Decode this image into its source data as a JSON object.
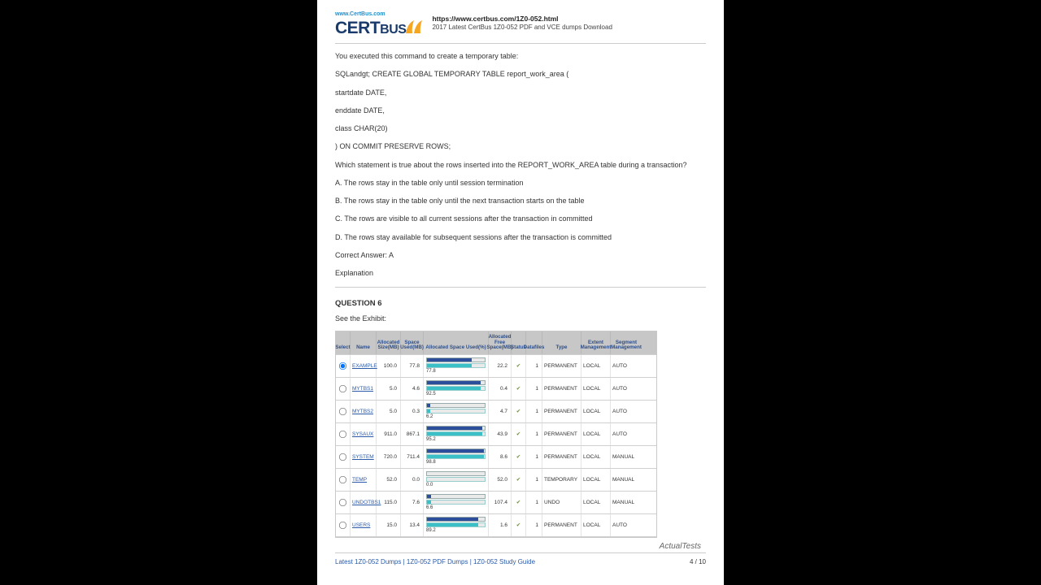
{
  "header": {
    "logo_url": "www.CertBus.com",
    "logo_main": "CERT",
    "logo_suffix": "BUS",
    "url_line": "https://www.certbus.com/1Z0-052.html",
    "subtitle": "2017 Latest CertBus 1Z0-052 PDF and VCE dumps Download"
  },
  "body": {
    "p1": "You executed this command to create a temporary table:",
    "p2": "SQLandgt; CREATE GLOBAL TEMPORARY TABLE report_work_area (",
    "p3": "startdate DATE,",
    "p4": "enddate DATE,",
    "p5": "class CHAR(20)",
    "p6": ") ON COMMIT PRESERVE ROWS;",
    "p7": "Which statement is true about the rows inserted into the REPORT_WORK_AREA table during a transaction?",
    "optA": "A. The rows stay in the table only until session termination",
    "optB": "B. The rows stay in the table only until the next transaction starts on the table",
    "optC": "C. The rows are visible to all current sessions after the transaction in committed",
    "optD": "D. The rows stay available for subsequent sessions after the transaction is committed",
    "answer": "Correct Answer: A",
    "expl": "Explanation"
  },
  "q6": {
    "title": "QUESTION 6",
    "see": "See the Exhibit:",
    "headers": [
      "Select",
      "Name",
      "Allocated Size(MB)",
      "Space Used(MB)",
      "Allocated Space Used(%)",
      "Allocated Free Space(MB)",
      "Status",
      "Datafiles",
      "Type",
      "Extent Management",
      "Segment Management"
    ],
    "rows": [
      {
        "sel": true,
        "name": "EXAMPLE",
        "alloc": "100.0",
        "used": "77.8",
        "pct_top": 77.8,
        "pct_bot": 77.8,
        "lbl": "77.8",
        "free": "22.2",
        "status": "✔",
        "datafiles": "1",
        "type": "PERMANENT",
        "ext": "LOCAL",
        "seg": "AUTO"
      },
      {
        "sel": false,
        "name": "MYTBS1",
        "alloc": "5.0",
        "used": "4.6",
        "pct_top": 92.5,
        "pct_bot": 92.5,
        "lbl": "92.5",
        "free": "0.4",
        "status": "✔",
        "datafiles": "1",
        "type": "PERMANENT",
        "ext": "LOCAL",
        "seg": "AUTO"
      },
      {
        "sel": false,
        "name": "MYTBS2",
        "alloc": "5.0",
        "used": "0.3",
        "pct_top": 6.2,
        "pct_bot": 6.2,
        "lbl": "6.2",
        "free": "4.7",
        "status": "✔",
        "datafiles": "1",
        "type": "PERMANENT",
        "ext": "LOCAL",
        "seg": "AUTO"
      },
      {
        "sel": false,
        "name": "SYSAUX",
        "alloc": "911.0",
        "used": "867.1",
        "pct_top": 95.2,
        "pct_bot": 95.2,
        "lbl": "95.2",
        "free": "43.9",
        "status": "✔",
        "datafiles": "1",
        "type": "PERMANENT",
        "ext": "LOCAL",
        "seg": "AUTO"
      },
      {
        "sel": false,
        "name": "SYSTEM",
        "alloc": "720.0",
        "used": "711.4",
        "pct_top": 98.8,
        "pct_bot": 98.8,
        "lbl": "98.8",
        "free": "8.6",
        "status": "✔",
        "datafiles": "1",
        "type": "PERMANENT",
        "ext": "LOCAL",
        "seg": "MANUAL"
      },
      {
        "sel": false,
        "name": "TEMP",
        "alloc": "52.0",
        "used": "0.0",
        "pct_top": 0,
        "pct_bot": 0,
        "lbl": "0.0",
        "free": "52.0",
        "status": "✔",
        "datafiles": "1",
        "type": "TEMPORARY",
        "ext": "LOCAL",
        "seg": "MANUAL"
      },
      {
        "sel": false,
        "name": "UNDOTBS1",
        "alloc": "115.0",
        "used": "7.6",
        "pct_top": 6.6,
        "pct_bot": 6.6,
        "lbl": "6.6",
        "free": "107.4",
        "status": "✔",
        "datafiles": "1",
        "type": "UNDO",
        "ext": "LOCAL",
        "seg": "MANUAL"
      },
      {
        "sel": false,
        "name": "USERS",
        "alloc": "15.0",
        "used": "13.4",
        "pct_top": 89.2,
        "pct_bot": 89.2,
        "lbl": "89.2",
        "free": "1.6",
        "status": "✔",
        "datafiles": "1",
        "type": "PERMANENT",
        "ext": "LOCAL",
        "seg": "AUTO"
      }
    ]
  },
  "footer": {
    "links": "Latest 1Z0-052 Dumps | 1Z0-052 PDF Dumps | 1Z0-052 Study Guide",
    "page": "4 / 10"
  },
  "watermark": "ActualTests"
}
